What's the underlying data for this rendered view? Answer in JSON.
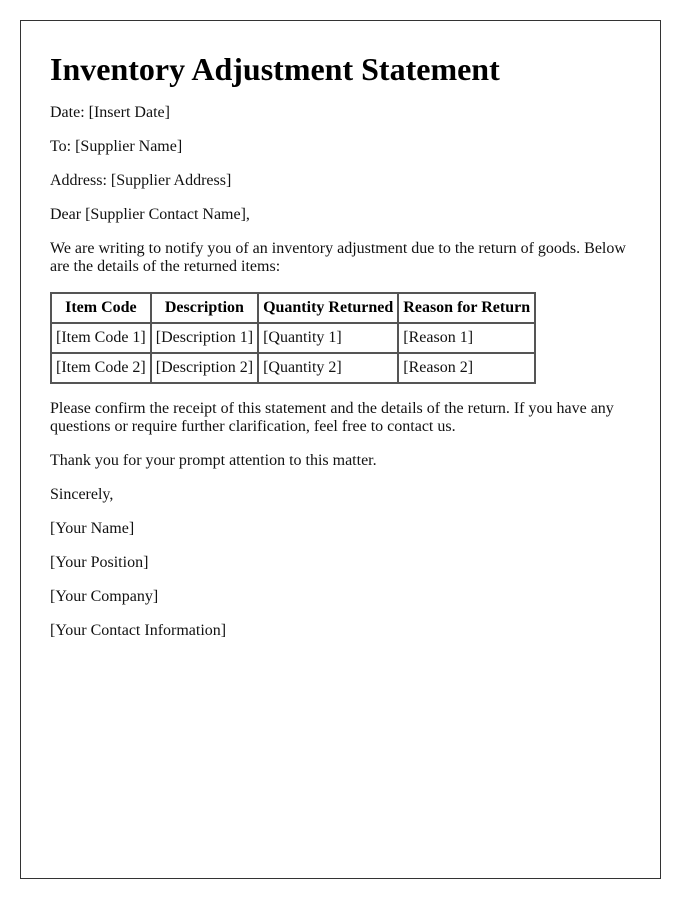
{
  "document": {
    "title": "Inventory Adjustment Statement",
    "date_line": "Date: [Insert Date]",
    "to_line": "To: [Supplier Name]",
    "address_line": "Address: [Supplier Address]",
    "salutation": "Dear [Supplier Contact Name],",
    "intro": "We are writing to notify you of an inventory adjustment due to the return of goods. Below are the details of the returned items:",
    "table": {
      "headers": [
        "Item Code",
        "Description",
        "Quantity Returned",
        "Reason for Return"
      ],
      "rows": [
        [
          "[Item Code 1]",
          "[Description 1]",
          "[Quantity 1]",
          "[Reason 1]"
        ],
        [
          "[Item Code 2]",
          "[Description 2]",
          "[Quantity 2]",
          "[Reason 2]"
        ]
      ]
    },
    "confirm_paragraph": "Please confirm the receipt of this statement and the details of the return. If you have any questions or require further clarification, feel free to contact us.",
    "thanks": "Thank you for your prompt attention to this matter.",
    "closing": "Sincerely,",
    "signature": {
      "name": "[Your Name]",
      "position": "[Your Position]",
      "company": "[Your Company]",
      "contact": "[Your Contact Information]"
    }
  }
}
